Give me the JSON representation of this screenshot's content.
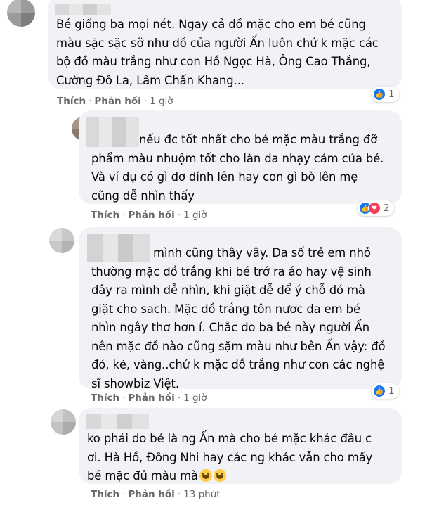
{
  "comments": [
    {
      "text": "Bé giống ba mọi nét. Ngay cả đồ mặc cho em bé cũng\nmàu sặc sặc sỡ như đồ của người Ấn luôn chứ k mặc các\nbộ đồ màu trắng như con Hồ Ngọc Hà, Ông Cao Thắng,\nCường Đô La, Lâm Chấn Khang...",
      "like_label": "Thích",
      "reply_label": "Phản hồi",
      "time": "1 giờ",
      "reaction_count": "1"
    },
    {
      "text": "nếu đc tốt nhất cho bé mặc màu trắng đỡ\nphẩm màu nhuộm tốt cho làn da nhạy cảm của bé.\nVà ví dụ có gì dơ dính lên hay con gì bò lên mẹ\ncũng dễ nhìn thấy",
      "like_label": "Thích",
      "reply_label": "Phản hồi",
      "time": "1 giờ",
      "reaction_count": "2"
    },
    {
      "text": "mình cũng thây vây. Da số trẻ em nhỏ\nthường mặc dồ trắng khi bé trớ ra áo hay vệ sinh\ndây ra mình dễ nhìn, khi giặt dễ dể ý chỗ dó mà\ngiặt cho sach. Mặc dồ trắng tôn nươc da em bé\nnhìn ngây thơ hơn í. Chắc do ba bé này người Ấn\nnên mặc đồ nào cũng sặm màu như bên Ấn vậy: đồ\nđỏ, kẻ, vàng..chứ k mặc dồ trắng như con các nghệ\nsĩ showbiz Việt.",
      "like_label": "Thích",
      "reply_label": "Phản hồi",
      "time": "1 giờ",
      "reaction_count": "1"
    },
    {
      "text": "ko phải do bé là ng Ấn mà cho bé mặc khác đâu c\nơi. Hà Hồ, Đông Nhi hay các ng khác vẫn cho mấy\nbé mặc đủ màu mà",
      "like_label": "Thích",
      "reply_label": "Phản hồi",
      "time": "13 phút",
      "reaction_count": ""
    }
  ],
  "icons": [
    "like-icon",
    "love-icon",
    "grinning-emoji-icon"
  ],
  "colors": {
    "bubble": "#f0f2f5",
    "like_blue": "#1877f2",
    "love_red": "#f33e58",
    "meta_grey": "#65676b"
  }
}
